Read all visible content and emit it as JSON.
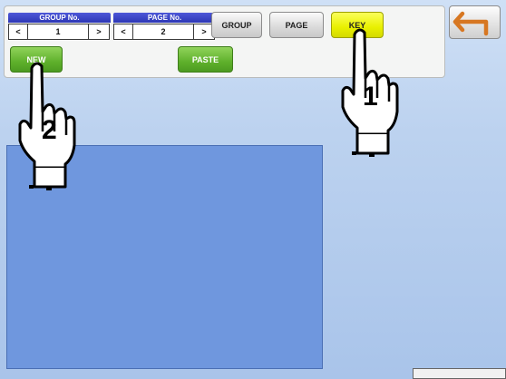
{
  "toolbar": {
    "group_stepper": {
      "title": "GROUP No.",
      "prev": "<",
      "value": "1",
      "next": ">"
    },
    "page_stepper": {
      "title": "PAGE No.",
      "prev": "<",
      "value": "2",
      "next": ">"
    },
    "group_label": "GROUP",
    "page_label": "PAGE",
    "key_label": "KEY",
    "new_label": "NEW",
    "paste_label": "PASTE"
  },
  "annotations": {
    "step1": "1",
    "step2": "2"
  },
  "colors": {
    "stepper_header": "#2c36b5",
    "key_button": "#e9f000",
    "green_buttons": "#5fb12c",
    "panel": "#6f97de"
  },
  "icons": {
    "return": "return-arrow-icon",
    "hand": "pointing-hand-icon"
  }
}
